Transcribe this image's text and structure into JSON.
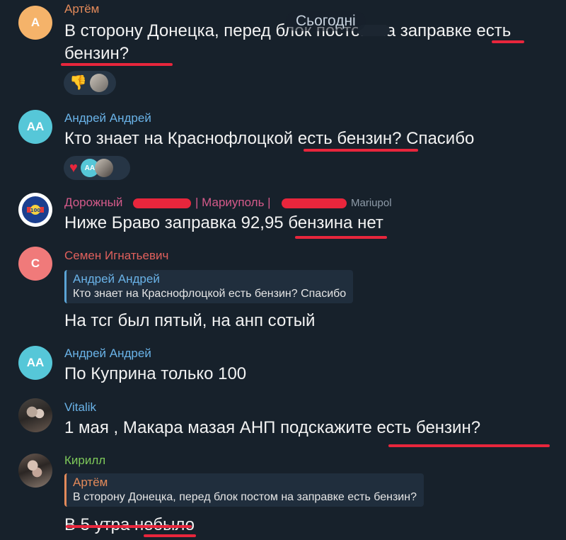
{
  "date_label": "Сьогодні",
  "colors": {
    "background": "#17212b",
    "highlight": "#e8263c",
    "reply_bar": "#5ba4d6"
  },
  "messages": [
    {
      "name": "Артём",
      "name_color": "#e38a5a",
      "avatar_initials": "А",
      "avatar_color": "#f5b36a",
      "text_line1": "В сторону Донецка, перед блок постом на заправке есть",
      "text_line2": "бензин?",
      "reactions": [
        "thumbs-down-icon",
        "user-photo"
      ]
    },
    {
      "name": "Андрей Андрей",
      "name_color": "#6ab3e8",
      "avatar_initials": "АА",
      "avatar_color": "#56c7d8",
      "text": "Кто знает на Краснофлоцкой есть бензин? Спасибо",
      "reactions": [
        "heart-icon",
        "AA",
        "user-photo"
      ],
      "reaction_initials": "AA"
    },
    {
      "name": "Дорожный",
      "name_mid": "| Мариуполь |",
      "name_color": "#d55a8a",
      "tag": "Mariupol",
      "text": "Ниже Браво заправка 92,95 бензина нет",
      "avatar_logo": "ДОРОЖНЫЙ МАРИУПОЛЬ 100"
    },
    {
      "name": "Семен Игнатьевич",
      "name_color": "#e0605c",
      "avatar_initials": "С",
      "avatar_color": "#f07a7a",
      "reply_name": "Андрей Андрей",
      "reply_text": "Кто знает на Краснофлоцкой есть бензин? Спасибо",
      "text": "На тсг был пятый, на анп сотый"
    },
    {
      "name": "Андрей Андрей",
      "name_color": "#6ab3e8",
      "avatar_initials": "АА",
      "avatar_color": "#56c7d8",
      "text": "По Куприна только 100"
    },
    {
      "name": "Vitalik",
      "name_color": "#6ab3e8",
      "text": "1 мая , Макара мазая АНП подскажите есть бензин?"
    },
    {
      "name": "Кирилл",
      "name_color": "#7ec95a",
      "reply_name": "Артём",
      "reply_text": "В сторону Донецка, перед блок постом на заправке есть бензин?",
      "text": "В 5 утра небыло"
    }
  ]
}
